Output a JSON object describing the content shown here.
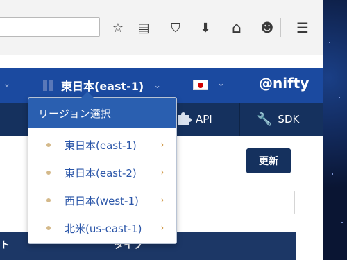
{
  "browser": {
    "toolbar_icons": [
      "star-icon",
      "reading-list-icon",
      "pocket-icon",
      "download-icon",
      "home-icon",
      "chat-icon",
      "menu-icon"
    ],
    "glyphs": {
      "star": "☆",
      "reading": "▤",
      "pocket": "⛉",
      "download": "⬇",
      "home": "⌂",
      "chat": "☻",
      "menu": "☰"
    }
  },
  "header": {
    "region_label": "東日本(east-1)",
    "chevron": "⌄",
    "brand": "@nifty",
    "colors": {
      "header_bg": "#1b4aa0",
      "subnav_bg": "#15315e"
    }
  },
  "subnav": {
    "api_label": "API",
    "sdk_label": "SDK",
    "wrench_glyph": "🔧"
  },
  "main": {
    "refresh_label": "更新",
    "table_headers": [
      "ト",
      "タイプ"
    ]
  },
  "dropdown": {
    "title": "リージョン選択",
    "chevron": "›",
    "items": [
      {
        "label": "東日本(east-1)"
      },
      {
        "label": "東日本(east-2)"
      },
      {
        "label": "西日本(west-1)"
      },
      {
        "label": "北米(us-east-1)"
      }
    ]
  }
}
